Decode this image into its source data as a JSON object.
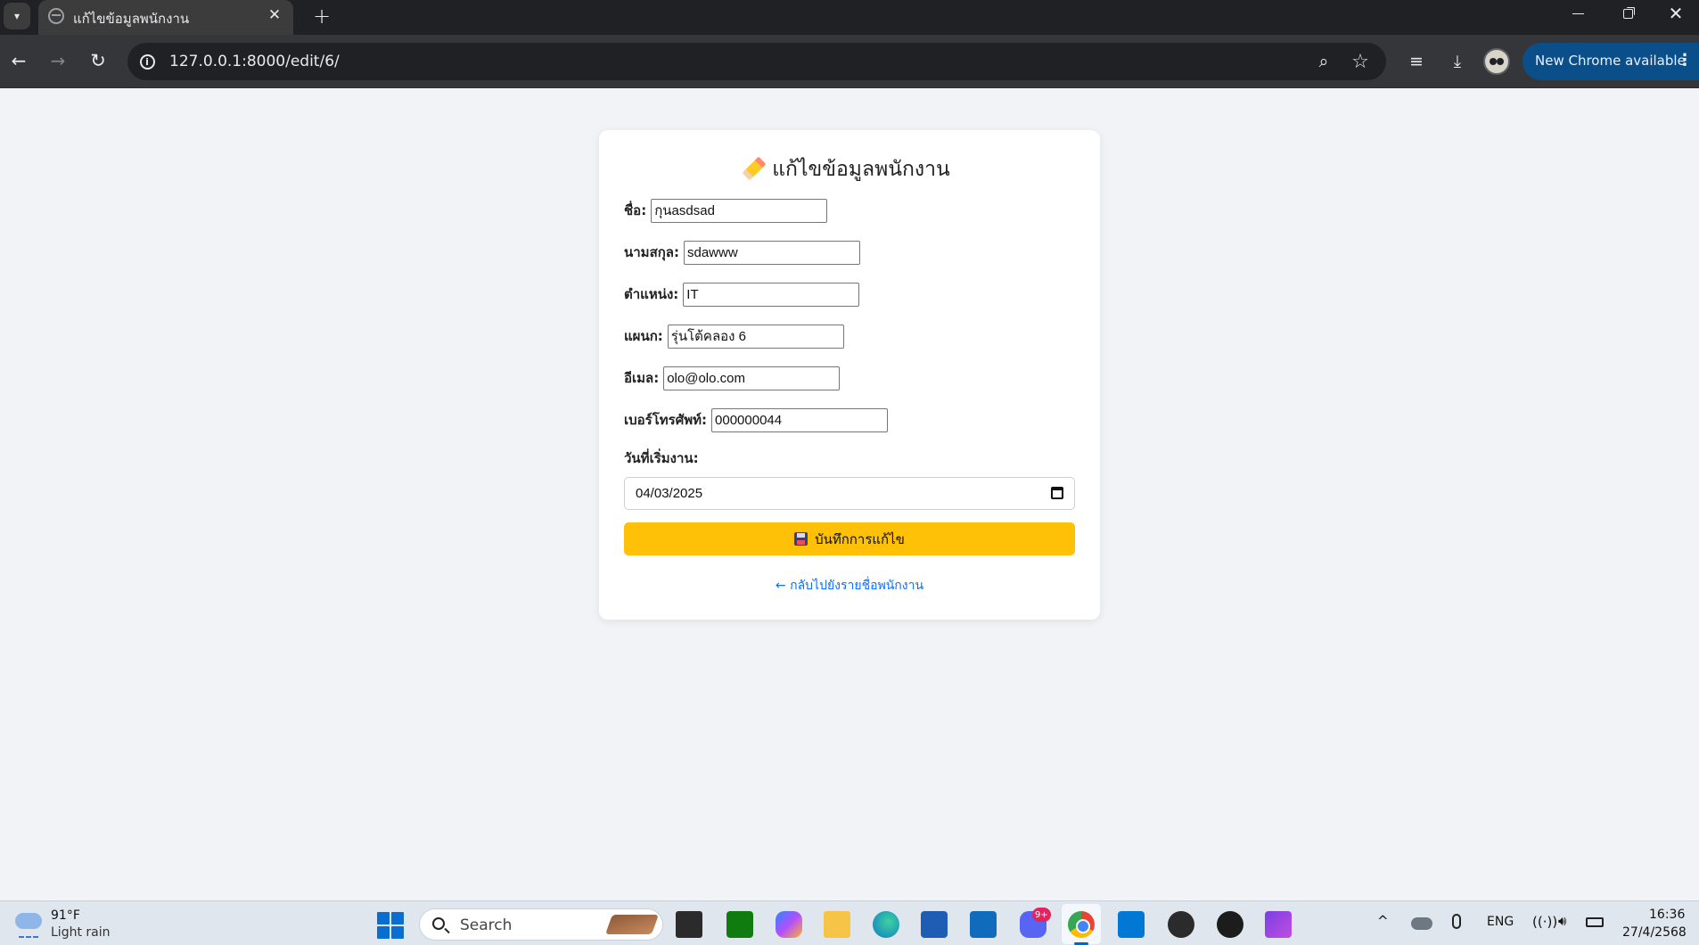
{
  "browser": {
    "tab": {
      "title": "แก้ไขข้อมูลพนักงาน",
      "close_glyph": "✕"
    },
    "new_tab_glyph": "+",
    "address": {
      "url": "127.0.0.1:8000/edit/6/"
    },
    "update_button": {
      "label": "New Chrome available",
      "menu_glyph": "⋮"
    },
    "icons": {
      "tab_list": "chevron-down-icon",
      "favicon": "globe-icon",
      "back": "arrow-left-icon",
      "forward": "arrow-right-icon",
      "reload": "reload-icon",
      "site_info": "info-icon",
      "zoom": "zoom-icon",
      "bookmark": "star-icon",
      "media": "media-control-icon",
      "download": "download-icon",
      "profile": "avatar"
    }
  },
  "page": {
    "title": "แก้ไขข้อมูลพนักงาน",
    "fields": {
      "first_name": {
        "label": "ชื่อ:",
        "value": "กุนasdsad"
      },
      "last_name": {
        "label": "นามสกุล:",
        "value": "sdawww"
      },
      "position": {
        "label": "ตำแหน่ง:",
        "value": "IT"
      },
      "department": {
        "label": "แผนก:",
        "value": "รุ่นโต้คลอง 6"
      },
      "email": {
        "label": "อีเมล:",
        "value": "olo@olo.com"
      },
      "phone": {
        "label": "เบอร์โทรศัพท์:",
        "value": "000000044"
      },
      "start_date": {
        "label": "วันที่เริ่มงาน:",
        "value": "04/03/2025"
      }
    },
    "save_button": {
      "label": "บันทึกการแก้ไข"
    },
    "back_link": {
      "label": "← กลับไปยังรายชื่อพนักงาน"
    },
    "colors": {
      "accent": "#ffc107",
      "link": "#0d6efd",
      "background": "#f2f3f7"
    }
  },
  "taskbar": {
    "weather": {
      "temp": "91°F",
      "desc": "Light rain"
    },
    "search": {
      "placeholder": "Search"
    },
    "apps": [
      "windows-start-icon",
      "task-view-icon",
      "xbox-icon",
      "copilot-icon",
      "file-explorer-icon",
      "edge-icon",
      "store-icon",
      "outlook-icon",
      "discord-icon",
      "chrome-icon",
      "vscode-icon",
      "obs-icon",
      "media-player-icon",
      "clapper-icon"
    ],
    "discord_badge": "9+",
    "tray": {
      "lang": "ENG",
      "chevron": "^"
    },
    "clock": {
      "time": "16:36",
      "date": "27/4/2568"
    }
  }
}
